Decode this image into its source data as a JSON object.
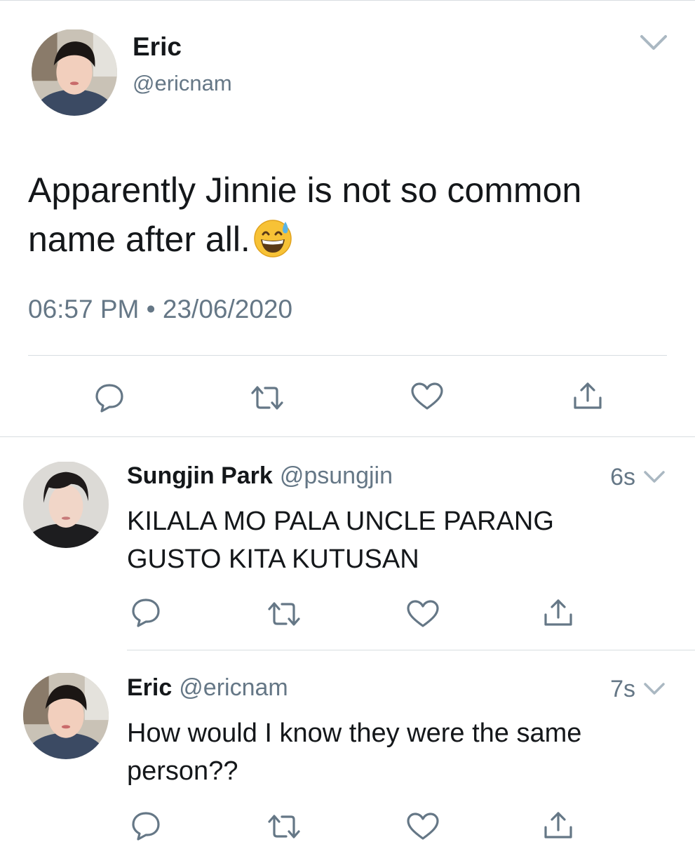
{
  "main_tweet": {
    "display_name": "Eric",
    "handle": "@ericnam",
    "text": "Apparently Jinnie is not so common name after all.",
    "emoji": "grinning-face-with-sweat",
    "time": "06:57 PM",
    "separator": "•",
    "date": "23/06/2020"
  },
  "replies": [
    {
      "display_name": "Sungjin Park",
      "handle": "@psungjin",
      "time": "6s",
      "text_line1": "KILALA MO PALA UNCLE PARANG",
      "text_line2": "GUSTO KITA KUTUSAN"
    },
    {
      "display_name": "Eric",
      "handle": "@ericnam",
      "time": "7s",
      "text_line1": "How would I know they were the same",
      "text_line2": "person??"
    }
  ],
  "colors": {
    "primary_text": "#14171a",
    "secondary_text": "#657786",
    "divider": "#d8dde1",
    "background": "#ffffff"
  },
  "icons": [
    "reply-icon",
    "retweet-icon",
    "like-icon",
    "share-icon",
    "chevron-down-icon"
  ]
}
